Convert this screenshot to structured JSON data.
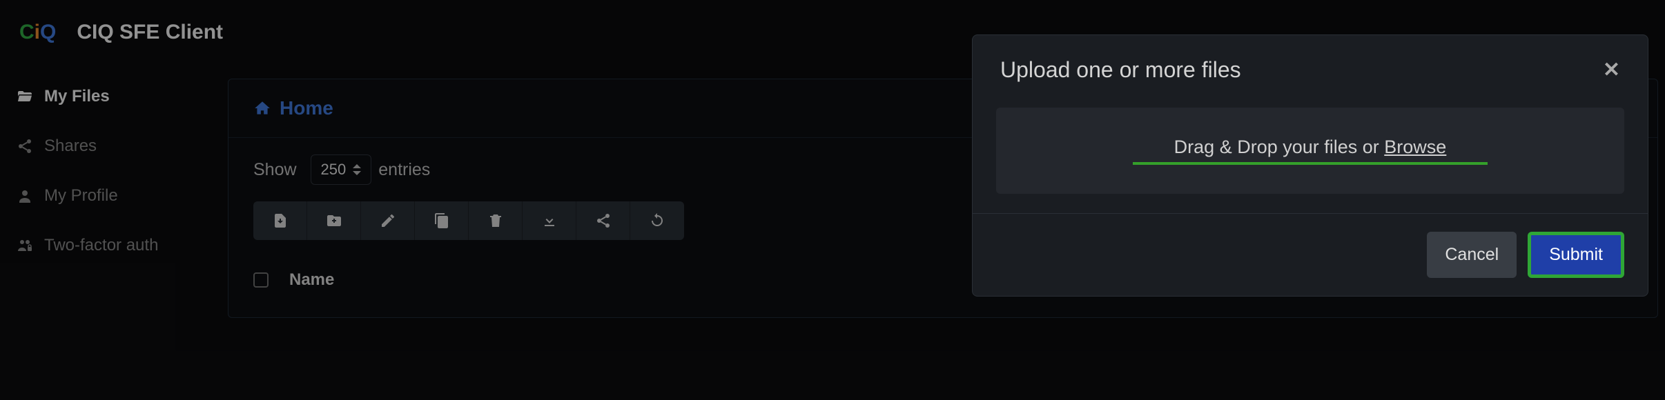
{
  "header": {
    "app_title": "CIQ SFE Client",
    "logo_c_text": "C",
    "logo_i_text": "i",
    "logo_q_text": "Q"
  },
  "sidebar": {
    "items": [
      {
        "label": "My Files",
        "icon": "folder-open-icon",
        "active": true
      },
      {
        "label": "Shares",
        "icon": "share-icon",
        "active": false
      },
      {
        "label": "My Profile",
        "icon": "user-icon",
        "active": false
      },
      {
        "label": "Two-factor auth",
        "icon": "users-lock-icon",
        "active": false
      }
    ]
  },
  "breadcrumb": {
    "home_label": "Home"
  },
  "entries_selector": {
    "show_label": "Show",
    "value": "250",
    "suffix_label": "entries"
  },
  "table": {
    "col_name": "Name"
  },
  "modal": {
    "title": "Upload one or more files",
    "drop_text_prefix": "Drag & Drop your files or ",
    "drop_browse": "Browse",
    "cancel_label": "Cancel",
    "submit_label": "Submit"
  }
}
